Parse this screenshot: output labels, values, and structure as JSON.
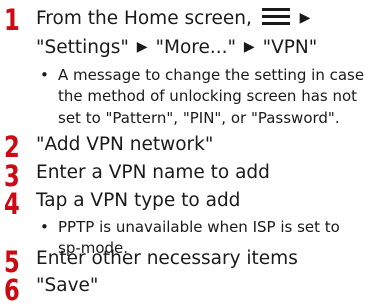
{
  "steps": [
    {
      "number": "1",
      "line1_prefix": "From the Home screen,",
      "menu_icon": "menu-icon",
      "arrow": "▶",
      "line2_items": [
        "\"Settings\"",
        "\"More...\"",
        "\"VPN\""
      ],
      "note": "A message to change the setting in case the method of unlocking screen has not set to \"Pattern\", \"PIN\", or \"Password\"."
    },
    {
      "number": "2",
      "text": "\"Add VPN network\""
    },
    {
      "number": "3",
      "text": "Enter a VPN name to add"
    },
    {
      "number": "4",
      "text": "Tap a VPN type to add",
      "note": "PPTP is unavailable when ISP is set to sp-mode."
    },
    {
      "number": "5",
      "text": "Enter other necessary items"
    },
    {
      "number": "6",
      "text": "\"Save\""
    }
  ],
  "bullet": "•",
  "colors": {
    "step_number": "#cc0a14",
    "text": "#1a1a1a",
    "background": "#ffffff"
  }
}
